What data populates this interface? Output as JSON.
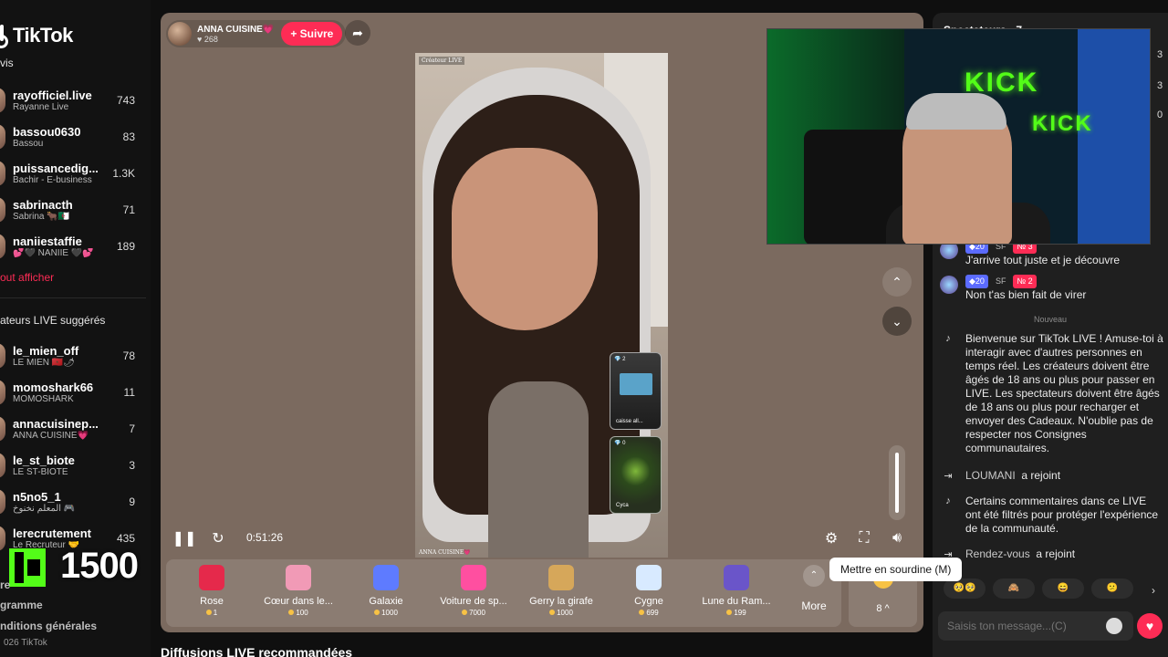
{
  "app": {
    "brand": "TikTok",
    "accent": "#fe2c55"
  },
  "sidebar": {
    "followed_label": "vis",
    "accounts": [
      {
        "user": "rayofficiel.live",
        "sub": "Rayanne Live",
        "count": "743"
      },
      {
        "user": "bassou0630",
        "sub": "Bassou",
        "count": "83"
      },
      {
        "user": "puissancedig...",
        "sub": "Bachir - E-business",
        "count": "1.3K"
      },
      {
        "user": "sabrinacth",
        "sub": "Sabrina 🐂🇩🇿",
        "count": "71"
      },
      {
        "user": "naniiestaffie",
        "sub": "💕🖤 NANIIE 🖤💕",
        "count": "189"
      }
    ],
    "see_all": "out afficher",
    "suggested_label": "ateurs LIVE suggérés",
    "suggested": [
      {
        "user": "le_mien_off",
        "sub": "LE MIEN 🇲🇦🌶",
        "count": "78"
      },
      {
        "user": "momoshark66",
        "sub": "MOMOSHARK",
        "count": "11"
      },
      {
        "user": "annacuisinep...",
        "sub": "ANNA CUISINE💗",
        "count": "7"
      },
      {
        "user": "le_st_biote",
        "sub": "LE ST-BIOTE",
        "count": "3"
      },
      {
        "user": "n5no5_1",
        "sub": "المعلم نخنوخ 🎮",
        "count": "9"
      },
      {
        "user": "lerecrutement",
        "sub": "Le Recruteur 🤝",
        "count": "435"
      }
    ],
    "kick_count": "1500",
    "footer": [
      "re",
      "gramme",
      "nditions générales"
    ],
    "copyright": "026 TikTok"
  },
  "player": {
    "host_name": "ANNA CUISINE💗",
    "host_likes": "♥ 268",
    "follow_label": "+ Suivre",
    "video_tag": "Créateur LIVE",
    "video_name": "ANNA CUISINE💗",
    "mini_guests": [
      {
        "count": "💎 2",
        "label": "caisse all..."
      },
      {
        "count": "💎 0",
        "label": "Cyca"
      }
    ],
    "elapsed": "0:51:26",
    "tooltip": "Mettre en sourdine (M)",
    "gifts": [
      {
        "name": "Rose",
        "price": "1",
        "color": "#e5294b"
      },
      {
        "name": "Cœur dans le...",
        "price": "100",
        "color": "#f19ab6"
      },
      {
        "name": "Galaxie",
        "price": "1000",
        "color": "#5e7bff"
      },
      {
        "name": "Voiture de sp...",
        "price": "7000",
        "color": "#ff4fa0"
      },
      {
        "name": "Gerry la girafe",
        "price": "1000",
        "color": "#d6a75a"
      },
      {
        "name": "Cygne",
        "price": "699",
        "color": "#d8eaff"
      },
      {
        "name": "Lune du Ram...",
        "price": "199",
        "color": "#6a55c9"
      }
    ],
    "more_label": "More",
    "wallet_count": "8 ^"
  },
  "recommended_title": "Diffusions LIVE recommandées",
  "chat": {
    "header": "Spectateurs · 7",
    "side_numbers": [
      "3",
      "3",
      "0"
    ],
    "messages": [
      {
        "level": "◆20",
        "tag": "SF",
        "rank": "№ 3",
        "text": "J'arrive tout juste et je découvre"
      },
      {
        "level": "◆20",
        "tag": "SF",
        "rank": "№ 2",
        "text": "Non t'as bien fait de virer"
      }
    ],
    "new_label": "Nouveau",
    "welcome": "Bienvenue sur TikTok LIVE ! Amuse-toi à interagir avec d'autres personnes en temps réel. Les créateurs doivent être âgés de 18 ans ou plus pour passer en LIVE. Les spectateurs doivent être âgés de 18 ans ou plus pour recharger et envoyer des Cadeaux. N'oublie pas de respecter nos Consignes communautaires.",
    "join1_user": "LOUMANI",
    "join1_text": "a rejoint",
    "filtered": "Certains commentaires dans ce LIVE ont été filtrés pour protéger l'expérience de la communauté.",
    "join2_user": "Rendez-vous",
    "join2_text": "a rejoint",
    "emojis": [
      "🥺🥺",
      "🙈",
      "😄",
      "😕"
    ],
    "input_placeholder": "Saisis ton message...(C)"
  }
}
